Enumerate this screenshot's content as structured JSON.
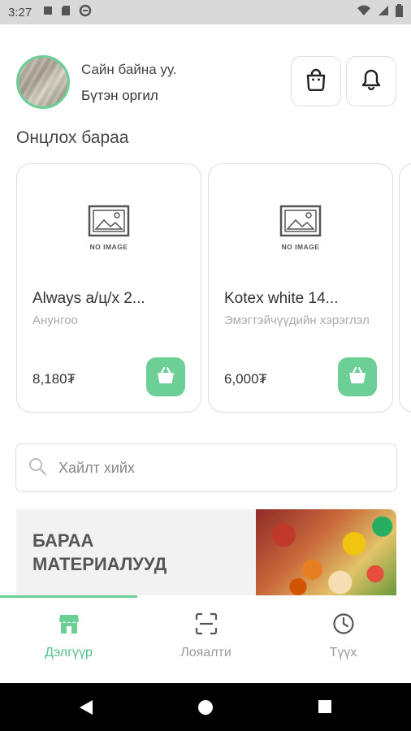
{
  "status_bar": {
    "time": "3:27"
  },
  "header": {
    "greeting": "Сайн байна уу.",
    "user_name": "Бүтэн оргил"
  },
  "featured": {
    "title": "Онцлох бараа",
    "no_image_text": "NO IMAGE",
    "products": [
      {
        "name": "Always а/ц/х 2...",
        "category": "Анунгоо",
        "price": "8,180₮"
      },
      {
        "name": "Kotex white 14...",
        "category": "Эмэгтэйчүүдийн хэрэглэл",
        "price": "6,000₮"
      }
    ]
  },
  "search": {
    "placeholder": "Хайлт хийх"
  },
  "banner": {
    "title_line1": "БАРАА",
    "title_line2": "МАТЕРИАЛУУД"
  },
  "nav": {
    "items": [
      {
        "label": "Дэлгүүр",
        "icon": "store-icon",
        "active": true
      },
      {
        "label": "Лояалти",
        "icon": "scan-icon",
        "active": false
      },
      {
        "label": "Түүх",
        "icon": "clock-icon",
        "active": false
      }
    ]
  },
  "colors": {
    "accent": "#6ccf96",
    "accent_text": "#52c287"
  }
}
